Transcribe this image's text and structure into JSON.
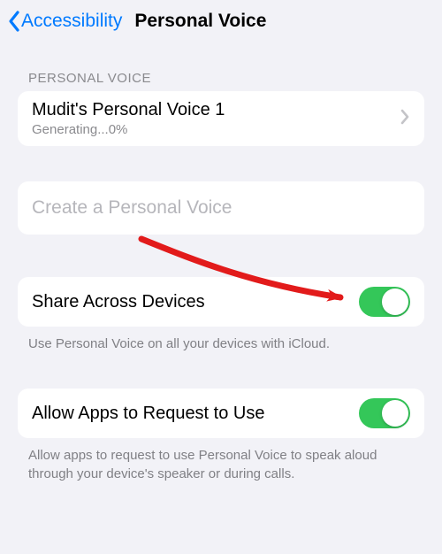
{
  "nav": {
    "back_label": "Accessibility",
    "title": "Personal Voice"
  },
  "section1": {
    "header": "PERSONAL VOICE",
    "voice_name": "Mudit's Personal Voice 1",
    "voice_status": "Generating...0%"
  },
  "create": {
    "label": "Create a Personal Voice"
  },
  "share": {
    "label": "Share Across Devices",
    "on": true,
    "footer": "Use Personal Voice on all your devices with iCloud."
  },
  "allow": {
    "label": "Allow Apps to Request to Use",
    "on": true,
    "footer": "Allow apps to request to use Personal Voice to speak aloud through your device's speaker or during calls."
  },
  "colors": {
    "accent": "#007aff",
    "toggle_on": "#34c759",
    "annotation": "#e21b1b"
  }
}
